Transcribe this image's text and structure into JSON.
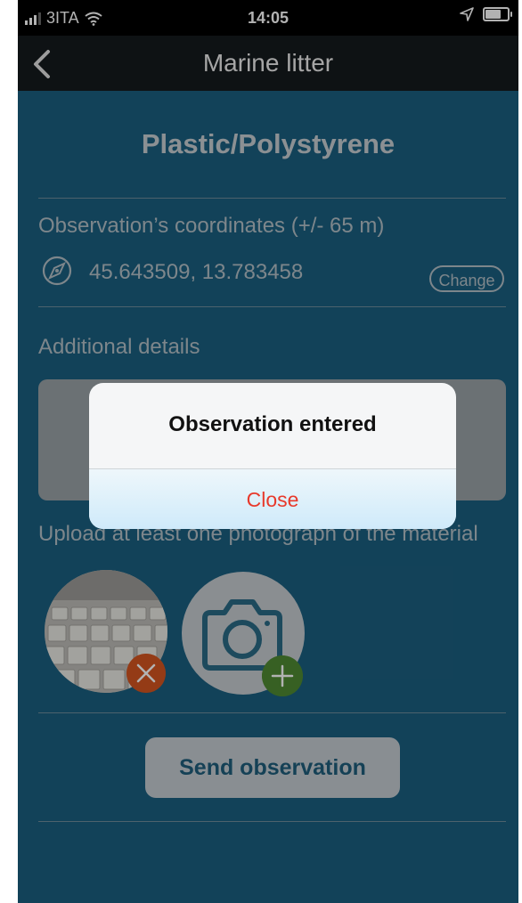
{
  "status_bar": {
    "carrier": "3ITA",
    "time": "14:05"
  },
  "nav": {
    "title": "Marine litter",
    "back_icon": "chevron-left-icon"
  },
  "page": {
    "heading": "Plastic/Polystyrene",
    "coordinates_label": "Observation’s coordinates (+/- 65 m)",
    "coordinates_value": "45.643509, 13.783458",
    "change_label": "Change",
    "details_label": "Additional details",
    "upload_label": "Upload at least one photograph of the material",
    "send_label": "Send observation"
  },
  "dialog": {
    "title": "Observation entered",
    "close_label": "Close"
  },
  "colors": {
    "background": "#1b5f80",
    "navbar": "#151a1d",
    "button": "#c5ccd1",
    "remove_badge": "#d55520",
    "add_badge": "#4f8a33",
    "close_text": "#e8392b"
  }
}
